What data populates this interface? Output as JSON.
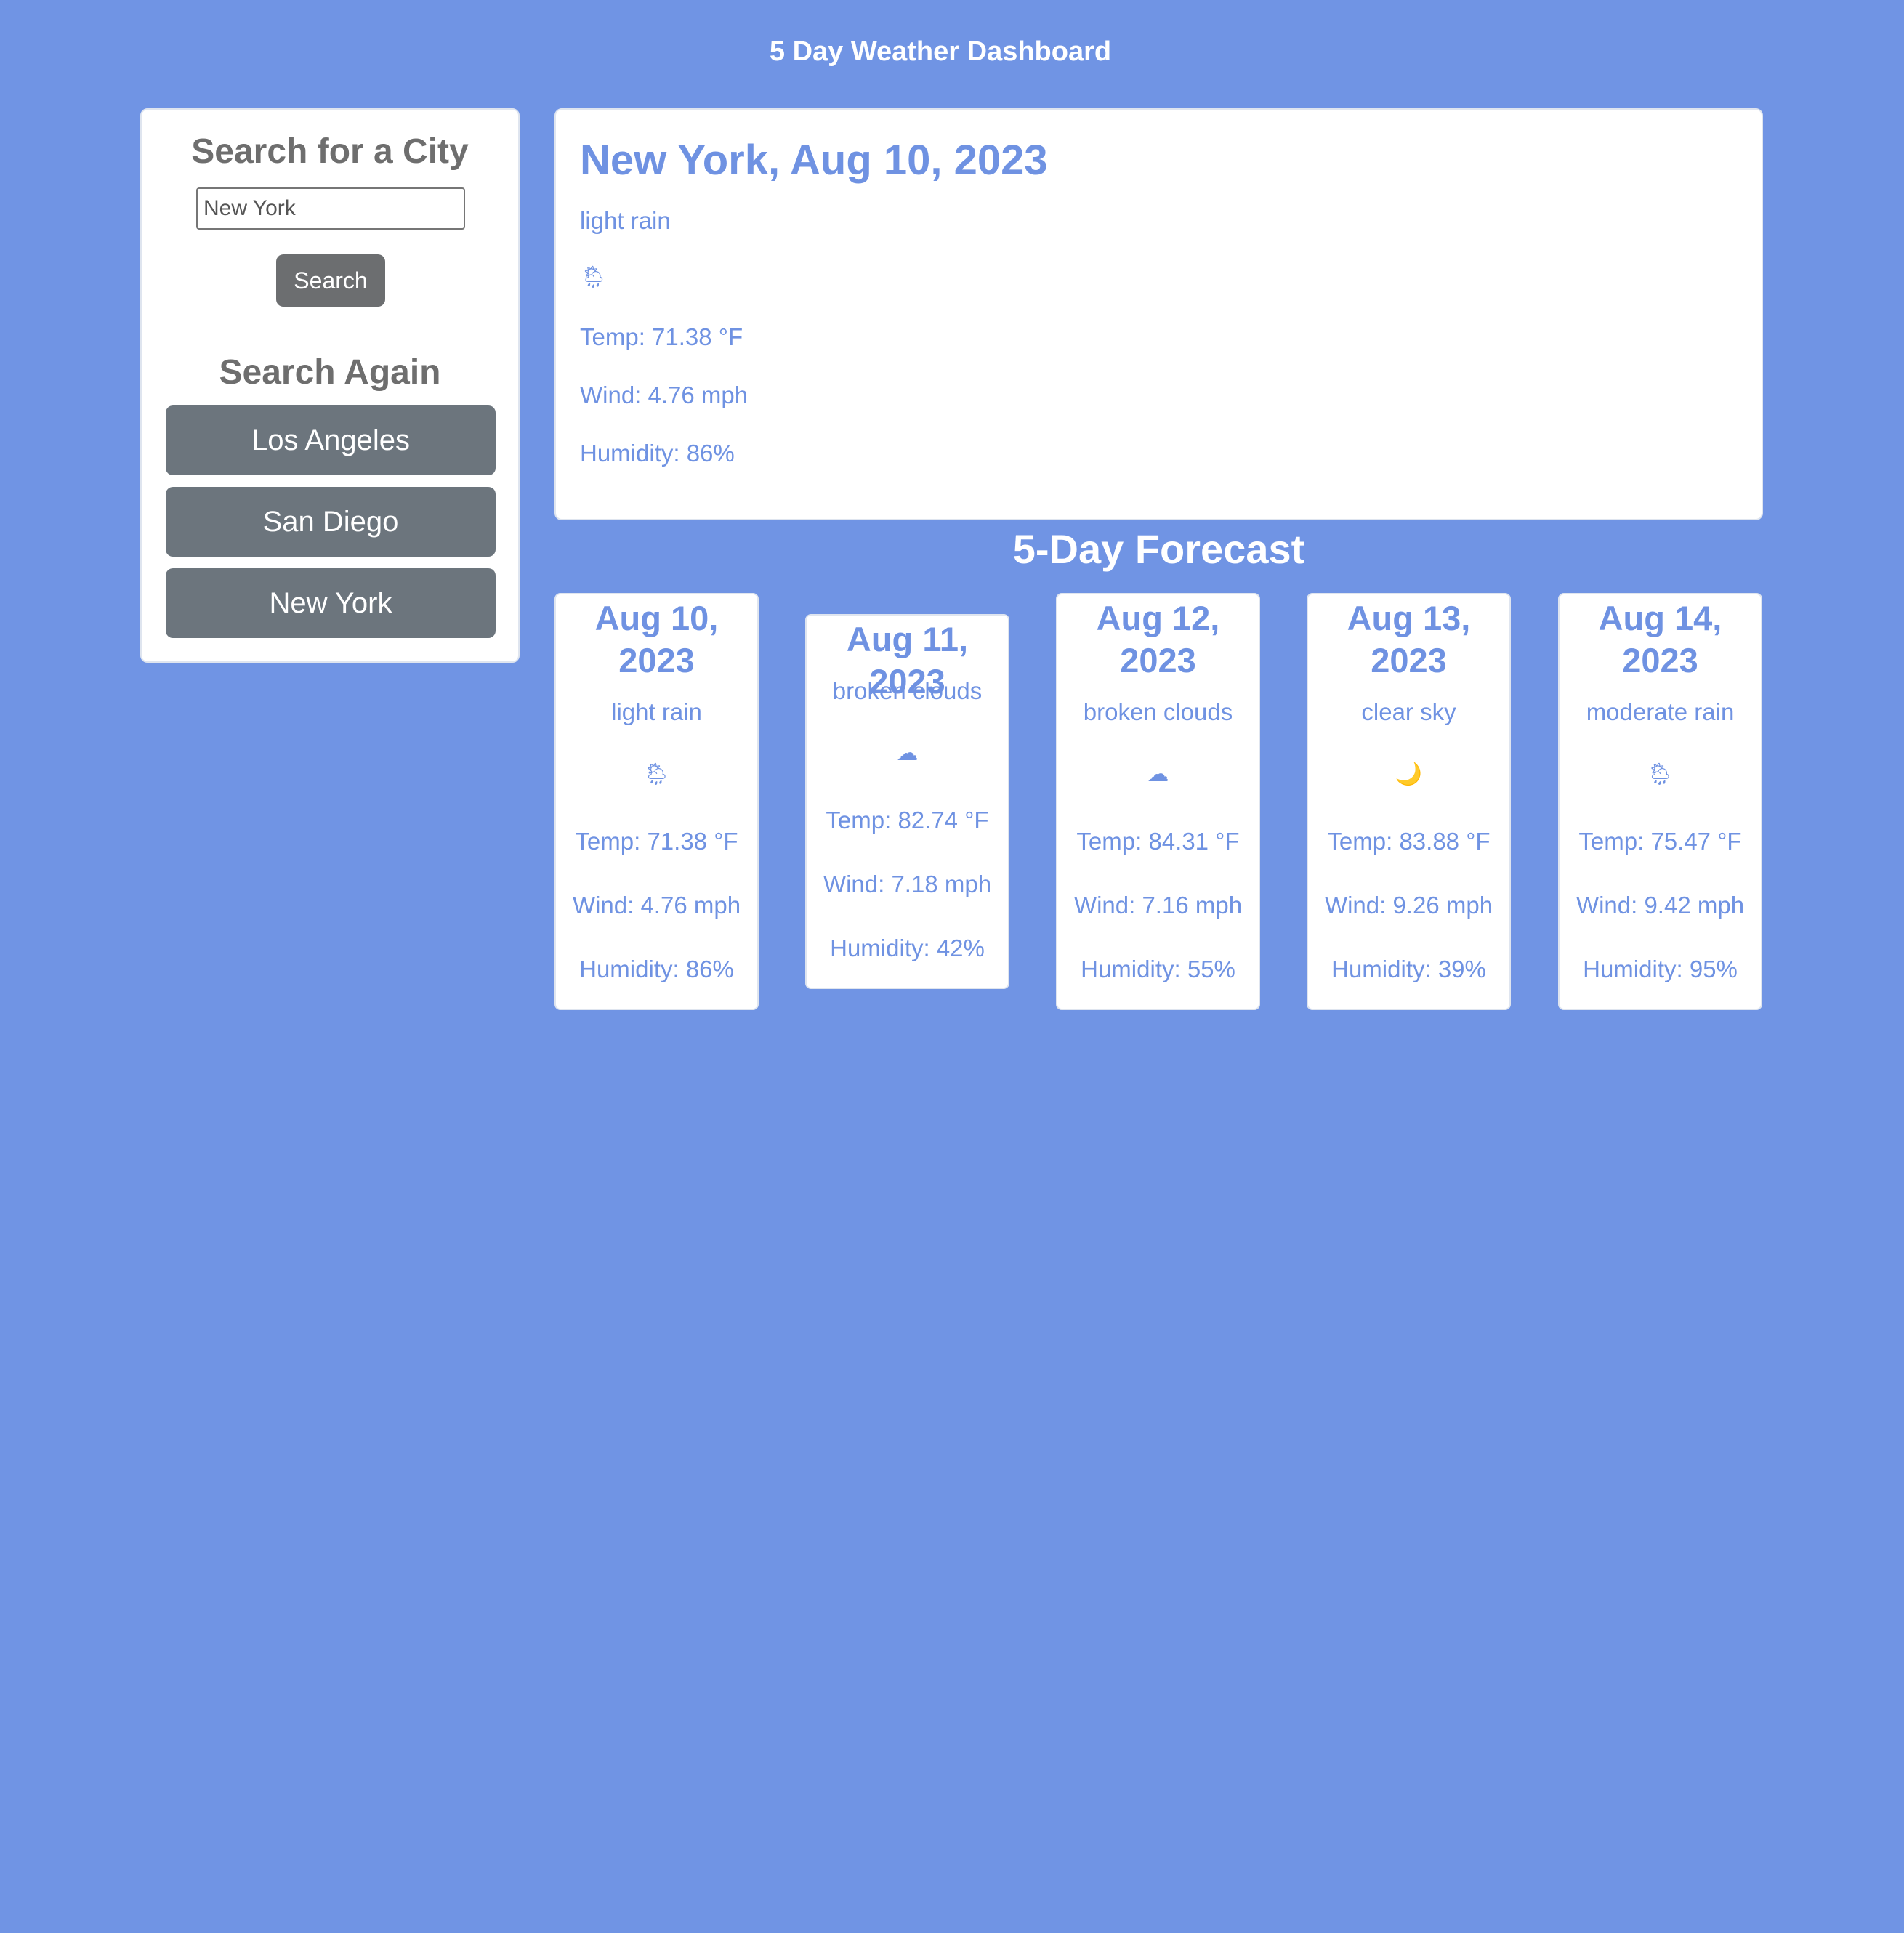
{
  "header": {
    "title": "5 Day Weather Dashboard"
  },
  "search": {
    "title": "Search for a City",
    "input_value": "New York",
    "button_label": "Search",
    "again_title": "Search Again",
    "history": [
      "Los Angeles",
      "San Diego",
      "New York"
    ]
  },
  "current": {
    "heading": "New York, Aug 10, 2023",
    "description": "light rain",
    "icon": "rain-cloud-sun-icon",
    "icon_glyph": "🌦",
    "temp": "Temp: 71.38 °F",
    "wind": "Wind: 4.76 mph",
    "humidity": "Humidity: 86%"
  },
  "forecast": {
    "title": "5-Day Forecast",
    "days": [
      {
        "date": "Aug 10, 2023",
        "description": "light rain",
        "icon": "rain-cloud-sun-icon",
        "icon_glyph": "🌦",
        "temp": "Temp: 71.38 °F",
        "wind": "Wind: 4.76 mph",
        "humidity": "Humidity: 86%"
      },
      {
        "date": "Aug 11, 2023",
        "description": "broken clouds",
        "icon": "cloud-icon",
        "icon_glyph": "☁",
        "temp": "Temp: 82.74 °F",
        "wind": "Wind: 7.18 mph",
        "humidity": "Humidity: 42%"
      },
      {
        "date": "Aug 12, 2023",
        "description": "broken clouds",
        "icon": "cloud-icon",
        "icon_glyph": "☁",
        "temp": "Temp: 84.31 °F",
        "wind": "Wind: 7.16 mph",
        "humidity": "Humidity: 55%"
      },
      {
        "date": "Aug 13, 2023",
        "description": "clear sky",
        "icon": "crescent-moon-icon",
        "icon_glyph": "🌙",
        "temp": "Temp: 83.88 °F",
        "wind": "Wind: 9.26 mph",
        "humidity": "Humidity: 39%"
      },
      {
        "date": "Aug 14, 2023",
        "description": "moderate rain",
        "icon": "rain-cloud-sun-icon",
        "icon_glyph": "🌦",
        "temp": "Temp: 75.47 °F",
        "wind": "Wind: 9.42 mph",
        "humidity": "Humidity: 95%"
      }
    ]
  },
  "colors": {
    "background": "#7094e4",
    "accent_text": "#6f92e2",
    "button": "#6c757d"
  }
}
